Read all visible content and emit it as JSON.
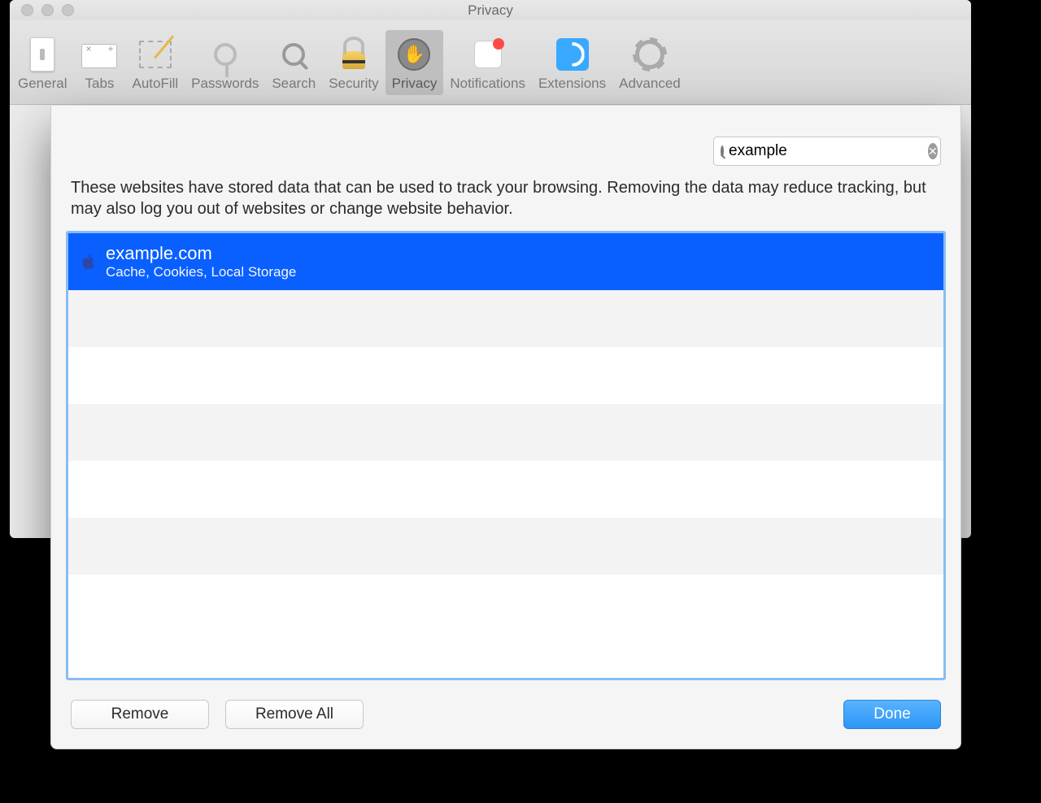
{
  "window": {
    "title": "Privacy"
  },
  "toolbar": {
    "items": [
      {
        "label": "General"
      },
      {
        "label": "Tabs"
      },
      {
        "label": "AutoFill"
      },
      {
        "label": "Passwords"
      },
      {
        "label": "Search"
      },
      {
        "label": "Security"
      },
      {
        "label": "Privacy"
      },
      {
        "label": "Notifications"
      },
      {
        "label": "Extensions"
      },
      {
        "label": "Advanced"
      }
    ],
    "selected": "Privacy"
  },
  "sheet": {
    "search_value": "example",
    "description": "These websites have stored data that can be used to track your browsing. Removing the data may reduce tracking, but may also log you out of websites or change website behavior.",
    "rows": [
      {
        "domain": "example.com",
        "details": "Cache, Cookies, Local Storage",
        "selected": true
      }
    ],
    "buttons": {
      "remove": "Remove",
      "remove_all": "Remove All",
      "done": "Done"
    }
  }
}
